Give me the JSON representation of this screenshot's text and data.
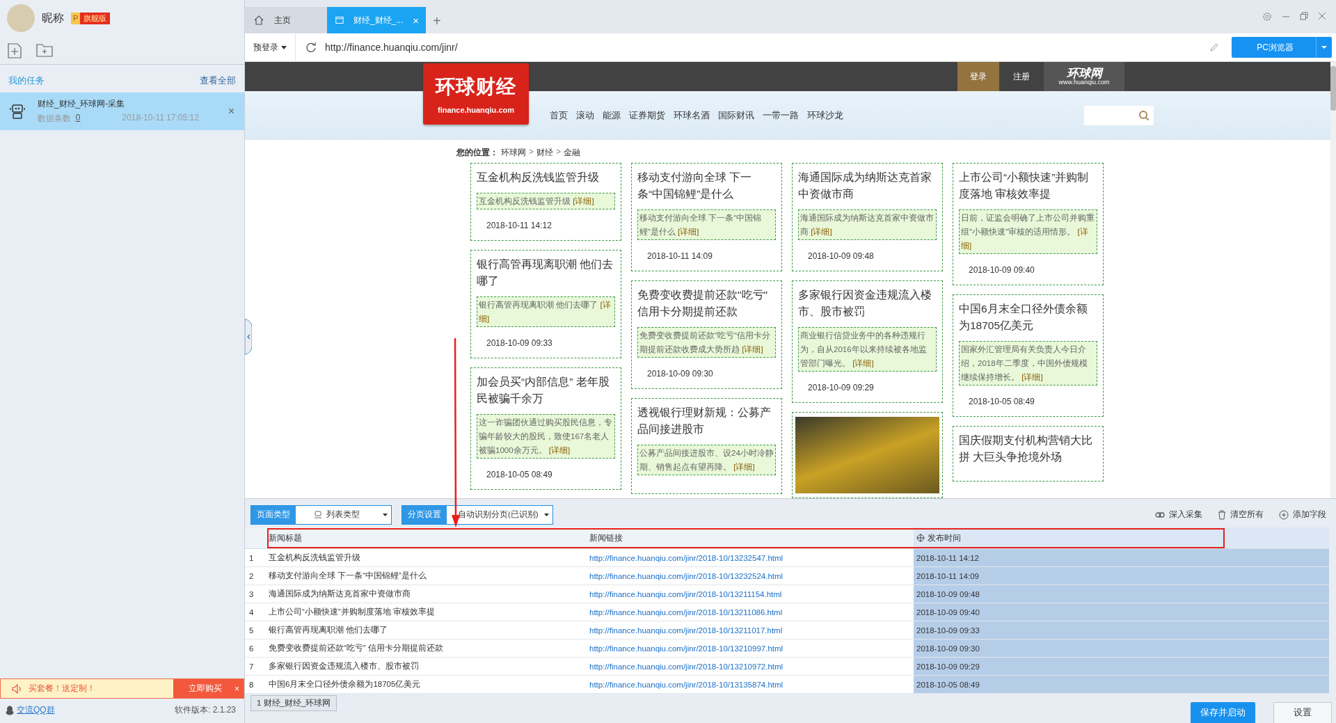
{
  "sidebar": {
    "user": {
      "nickname": "昵称",
      "badge_letter": "P",
      "badge": "旗舰版"
    },
    "section_title": "我的任务",
    "view_all": "查看全部",
    "tasks": [
      {
        "name": "财经_财经_环球网-采集",
        "count_label": "数据条数 : ",
        "count": "0",
        "time": "2018-10-11 17:05:12",
        "close": "×",
        "selected": true
      }
    ],
    "promo": {
      "text": "买套餐！送定制！",
      "button": "立即购买",
      "close": "×"
    },
    "footer": {
      "link": "交流QQ群",
      "version": "软件版本: 2.1.23"
    }
  },
  "browser": {
    "tabs": [
      {
        "kind": "home",
        "label": "主页",
        "selected": false
      },
      {
        "kind": "page",
        "label": "财经_财经_...",
        "close": "×",
        "selected": true
      }
    ],
    "new_tab": "+",
    "login_dropdown": "预登录",
    "url": "http://finance.huanqiu.com/jinr/",
    "mode_button": "PC浏览器"
  },
  "webpage": {
    "logo_text": "环球财经",
    "logo_domain": "finance.huanqiu.com",
    "login": "登录",
    "register": "注册",
    "site_logo": "环球网",
    "site_logo_domain": "www.huanqiu.com",
    "nav": [
      "首页",
      "滚动",
      "能源",
      "证券期货",
      "环球名酒",
      "国际财讯",
      "一带一路",
      "环球沙龙"
    ],
    "breadcrumb": {
      "label": "您的位置：",
      "separator": ">",
      "items": [
        "环球网",
        "财经",
        "金融"
      ]
    },
    "columns": [
      [
        {
          "kind": "article",
          "title": "互金机构反洗钱监管升级",
          "summary": "互金机构反洗钱监管升级",
          "more": "[详细]",
          "date": "2018-10-11 14:12"
        },
        {
          "kind": "article",
          "title": "银行高管再现离职潮 他们去哪了",
          "summary": "银行高管再现离职潮 他们去哪了",
          "more": "[详细]",
          "date": "2018-10-09 09:33"
        },
        {
          "kind": "article",
          "title": "加会员买“内部信息” 老年股民被骗千余万",
          "summary": "这一诈骗团伙通过购买股民信息，专骗年龄较大的股民，致使167名老人被骗1000余万元。",
          "more": "[详细]",
          "date": "2018-10-05 08:49"
        }
      ],
      [
        {
          "kind": "article",
          "title": "移动支付游向全球 下一条“中国锦鲤”是什么",
          "summary": "移动支付游向全球 下一条“中国锦鲤”是什么",
          "more": "[详细]",
          "date": "2018-10-11 14:09"
        },
        {
          "kind": "article",
          "title": "免费变收费提前还款\"吃亏\" 信用卡分期提前还款",
          "summary": "免费变收费提前还款\"吃亏\"信用卡分期提前还款收费成大势所趋",
          "more": "[详细]",
          "date": "2018-10-09 09:30"
        },
        {
          "kind": "article",
          "title": "透视银行理财新规：公募产品间接进股市",
          "summary": "公募产品间接进股市、设24小时冷静期、销售起点有望再降。",
          "more": "[详细]"
        }
      ],
      [
        {
          "kind": "article",
          "title": "海通国际成为纳斯达克首家中资做市商",
          "summary": "海通国际成为纳斯达克首家中资做市商",
          "more": "[详细]",
          "date": "2018-10-09 09:48"
        },
        {
          "kind": "article",
          "title": "多家银行因资金违规流入楼市、股市被罚",
          "summary": "商业银行信贷业务中的各种违规行为，自从2016年以来持续被各地监管部门曝光。",
          "more": "[详细]",
          "date": "2018-10-09 09:29"
        },
        {
          "kind": "photo"
        }
      ],
      [
        {
          "kind": "article",
          "title": "上市公司“小额快速”并购制度落地 审核效率提",
          "summary": "日前，证监会明确了上市公司并购重组\"小额快速\"审核的适用情形。",
          "more": "[详细]",
          "date": "2018-10-09 09:40"
        },
        {
          "kind": "article",
          "title": "中国6月末全口径外债余额为18705亿美元",
          "summary": "国家外汇管理局有关负责人今日介绍，2018年二季度，中国外债规模继续保持增长。",
          "more": "[详细]",
          "date": "2018-10-05 08:49"
        },
        {
          "kind": "article",
          "title": "国庆假期支付机构营销大比拼 大巨头争抢境外场"
        }
      ]
    ]
  },
  "panel": {
    "page_type_label": "页面类型",
    "page_type": "列表类型",
    "paging_label": "分页设置",
    "paging": "自动识别分页(已识别)",
    "actions": [
      {
        "kind": "link",
        "label": "深入采集"
      },
      {
        "kind": "trash",
        "label": "清空所有"
      },
      {
        "kind": "add",
        "label": "添加字段"
      }
    ],
    "table": {
      "columns": [
        {
          "kind": "text",
          "label": "新闻标题",
          "selected": false
        },
        {
          "kind": "link",
          "label": "新闻链接",
          "selected": false
        },
        {
          "kind": "text",
          "label": "发布时间",
          "selected": true
        }
      ],
      "rows": [
        {
          "index": "1",
          "cells": [
            "互金机构反洗钱监管升级",
            "http://finance.huanqiu.com/jinr/2018-10/13232547.html",
            "2018-10-11 14:12"
          ]
        },
        {
          "index": "2",
          "cells": [
            "移动支付游向全球 下一条“中国锦鲤”是什么",
            "http://finance.huanqiu.com/jinr/2018-10/13232524.html",
            "2018-10-11 14:09"
          ]
        },
        {
          "index": "3",
          "cells": [
            "海通国际成为纳斯达克首家中资做市商",
            "http://finance.huanqiu.com/jinr/2018-10/13211154.html",
            "2018-10-09 09:48"
          ]
        },
        {
          "index": "4",
          "cells": [
            "上市公司“小额快速”并购制度落地 审核效率提",
            "http://finance.huanqiu.com/jinr/2018-10/13211086.html",
            "2018-10-09 09:40"
          ]
        },
        {
          "index": "5",
          "cells": [
            "银行高管再现离职潮 他们去哪了",
            "http://finance.huanqiu.com/jinr/2018-10/13211017.html",
            "2018-10-09 09:33"
          ]
        },
        {
          "index": "6",
          "cells": [
            "免费变收费提前还款“吃亏” 信用卡分期提前还款",
            "http://finance.huanqiu.com/jinr/2018-10/13210997.html",
            "2018-10-09 09:30"
          ]
        },
        {
          "index": "7",
          "cells": [
            "多家银行因资金违规流入楼市、股市被罚",
            "http://finance.huanqiu.com/jinr/2018-10/13210972.html",
            "2018-10-09 09:29"
          ]
        },
        {
          "index": "8",
          "cells": [
            "中国6月末全口径外债余额为18705亿美元",
            "http://finance.huanqiu.com/jinr/2018-10/13135874.html",
            "2018-10-05 08:49"
          ]
        }
      ]
    },
    "task_tab": "1 财经_财经_环球网",
    "save_button": "保存并启动",
    "settings_button": "设置"
  }
}
